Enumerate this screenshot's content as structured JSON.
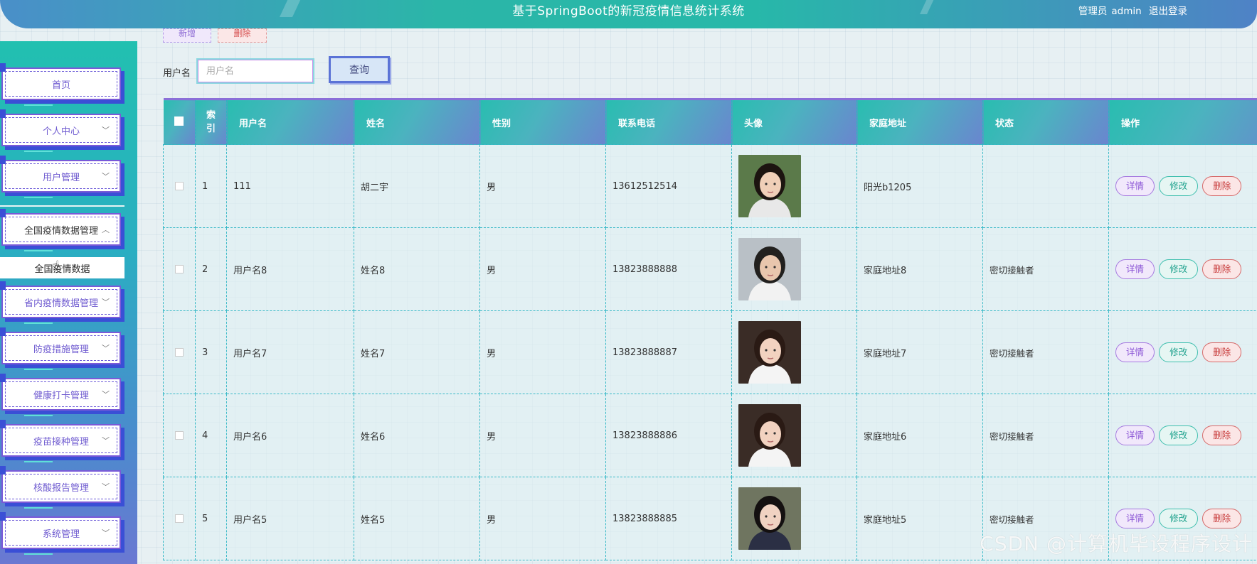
{
  "header": {
    "title": "基于SpringBoot的新冠疫情信息统计系统",
    "role": "管理员",
    "username": "admin",
    "logout": "退出登录"
  },
  "sidebar": {
    "items": [
      {
        "label": "首页",
        "chevron": ""
      },
      {
        "label": "个人中心",
        "chevron": "﹀"
      },
      {
        "label": "用户管理",
        "chevron": "﹀"
      },
      {
        "label": "全国疫情数据管理",
        "chevron": "︿"
      },
      {
        "label": "省内疫情数据管理",
        "chevron": "﹀"
      },
      {
        "label": "防疫措施管理",
        "chevron": "﹀"
      },
      {
        "label": "健康打卡管理",
        "chevron": "﹀"
      },
      {
        "label": "疫苗接种管理",
        "chevron": "﹀"
      },
      {
        "label": "核酸报告管理",
        "chevron": "﹀"
      },
      {
        "label": "系统管理",
        "chevron": "﹀"
      }
    ],
    "sub_item": "全国疫情数据"
  },
  "toolbar": {
    "add_label": "新增",
    "delete_label": "删除"
  },
  "search": {
    "label": "用户名",
    "placeholder": "用户名",
    "button": "查询"
  },
  "table": {
    "headers": {
      "index": "索引",
      "username": "用户名",
      "name": "姓名",
      "gender": "性别",
      "phone": "联系电话",
      "avatar": "头像",
      "address": "家庭地址",
      "status": "状态",
      "ops": "操作"
    },
    "rows": [
      {
        "index": "1",
        "username": "111",
        "name": "胡二宇",
        "gender": "男",
        "phone": "13612512514",
        "address": "阳光b1205",
        "status": ""
      },
      {
        "index": "2",
        "username": "用户名8",
        "name": "姓名8",
        "gender": "男",
        "phone": "13823888888",
        "address": "家庭地址8",
        "status": "密切接触者"
      },
      {
        "index": "3",
        "username": "用户名7",
        "name": "姓名7",
        "gender": "男",
        "phone": "13823888887",
        "address": "家庭地址7",
        "status": "密切接触者"
      },
      {
        "index": "4",
        "username": "用户名6",
        "name": "姓名6",
        "gender": "男",
        "phone": "13823888886",
        "address": "家庭地址6",
        "status": "密切接触者"
      },
      {
        "index": "5",
        "username": "用户名5",
        "name": "姓名5",
        "gender": "男",
        "phone": "13823888885",
        "address": "家庭地址5",
        "status": "密切接触者"
      }
    ],
    "actions": {
      "detail": "详情",
      "edit": "修改",
      "delete": "删除"
    }
  },
  "watermark": "CSDN @计算机毕设程序设计"
}
